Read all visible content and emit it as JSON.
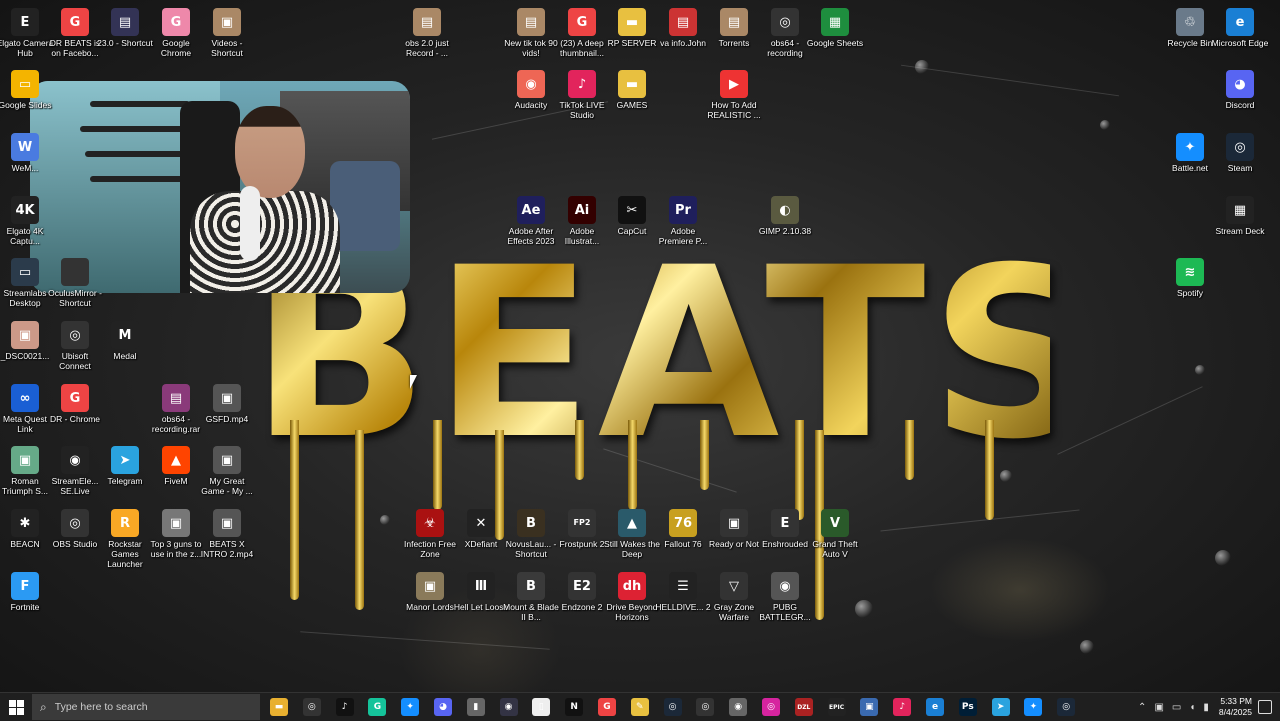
{
  "wallpaper": {
    "logo_text": "BEATS"
  },
  "desktop_icons": [
    {
      "label": "Elgato Camera Hub",
      "icon": "E",
      "color": "#222"
    },
    {
      "label": "DR BEATS is on Facebo...",
      "icon": "G",
      "color": "#e44"
    },
    {
      "label": "23.0 - Shortcut",
      "icon": "▤",
      "color": "#335"
    },
    {
      "label": "Google Chrome",
      "icon": "G",
      "color": "#e8a"
    },
    {
      "label": "Videos - Shortcut",
      "icon": "▣",
      "color": "#a86"
    },
    {
      "label": "obs 2.0 just Record - ...",
      "icon": "▤",
      "color": "#a86"
    },
    {
      "label": "New tik tok 90 vids!",
      "icon": "▤",
      "color": "#a86"
    },
    {
      "label": "(23) A deep thumbnail...",
      "icon": "G",
      "color": "#e44"
    },
    {
      "label": "RP SERVER",
      "icon": "▬",
      "color": "#e8c040"
    },
    {
      "label": "va info.John",
      "icon": "▤",
      "color": "#c33"
    },
    {
      "label": "Torrents",
      "icon": "▤",
      "color": "#a86"
    },
    {
      "label": "obs64 - recording",
      "icon": "◎",
      "color": "#333"
    },
    {
      "label": "Google Sheets",
      "icon": "▦",
      "color": "#1e8e3e"
    },
    {
      "label": "Recycle Bin",
      "icon": "♲",
      "color": "#6a7a8a"
    },
    {
      "label": "Microsoft Edge",
      "icon": "e",
      "color": "#1a7fd4"
    },
    {
      "label": "Google Slides",
      "icon": "▭",
      "color": "#f4b400"
    },
    {
      "label": "Audacity",
      "icon": "◉",
      "color": "#e65"
    },
    {
      "label": "TikTok LIVE Studio",
      "icon": "♪",
      "color": "#e2245c"
    },
    {
      "label": "GAMES",
      "icon": "▬",
      "color": "#e8c040"
    },
    {
      "label": "How To Add REALISTIC ...",
      "icon": "▶",
      "color": "#e33"
    },
    {
      "label": "Discord",
      "icon": "◕",
      "color": "#5865f2"
    },
    {
      "label": "WeM...",
      "icon": "W",
      "color": "#4a7be0"
    },
    {
      "label": "Battle.net",
      "icon": "✦",
      "color": "#148eff"
    },
    {
      "label": "Steam",
      "icon": "◎",
      "color": "#1b2838"
    },
    {
      "label": "Elgato 4K Captu...",
      "icon": "4K",
      "color": "#222"
    },
    {
      "label": "Adobe After Effects 2023",
      "icon": "Ae",
      "color": "#1f1f5c"
    },
    {
      "label": "Adobe Illustrat...",
      "icon": "Ai",
      "color": "#330000"
    },
    {
      "label": "CapCut",
      "icon": "✂",
      "color": "#111"
    },
    {
      "label": "Adobe Premiere P...",
      "icon": "Pr",
      "color": "#1f1f5c"
    },
    {
      "label": "GIMP 2.10.38",
      "icon": "◐",
      "color": "#5a5a40"
    },
    {
      "label": "Stream Deck",
      "icon": "▦",
      "color": "#222"
    },
    {
      "label": "Streamlabs Desktop",
      "icon": "▭",
      "color": "#2b3b4b"
    },
    {
      "label": "OculusMirror - Shortcut",
      "icon": "",
      "color": "#333"
    },
    {
      "label": "Spotify",
      "icon": "≋",
      "color": "#1db954"
    },
    {
      "label": "_DSC0021...",
      "icon": "▣",
      "color": "#c98"
    },
    {
      "label": "Ubisoft Connect",
      "icon": "◎",
      "color": "#333"
    },
    {
      "label": "Medal",
      "icon": "M",
      "color": "#222"
    },
    {
      "label": "Meta Quest Link",
      "icon": "∞",
      "color": "#1a5fd4"
    },
    {
      "label": "DR - Chrome",
      "icon": "G",
      "color": "#e44"
    },
    {
      "label": "obs64 - recording.rar",
      "icon": "▤",
      "color": "#8a3a7a"
    },
    {
      "label": "GSFD.mp4",
      "icon": "▣",
      "color": "#555"
    },
    {
      "label": "Roman Triumph S...",
      "icon": "▣",
      "color": "#6a8"
    },
    {
      "label": "StreamEle... SE.Live",
      "icon": "◉",
      "color": "#222"
    },
    {
      "label": "Telegram",
      "icon": "➤",
      "color": "#2aa3df"
    },
    {
      "label": "FiveM",
      "icon": "▲",
      "color": "#f40"
    },
    {
      "label": "My Great Game - My ...",
      "icon": "▣",
      "color": "#555"
    },
    {
      "label": "BEACN",
      "icon": "✱",
      "color": "#222"
    },
    {
      "label": "OBS Studio",
      "icon": "◎",
      "color": "#333"
    },
    {
      "label": "Rockstar Games Launcher",
      "icon": "R",
      "color": "#f9a825"
    },
    {
      "label": "Top 3 guns to use in the z...",
      "icon": "▣",
      "color": "#777"
    },
    {
      "label": "BEATS X INTRO 2.mp4",
      "icon": "▣",
      "color": "#555"
    },
    {
      "label": "Fortnite",
      "icon": "F",
      "color": "#2b9af3"
    },
    {
      "label": "Infection Free Zone",
      "icon": "☣",
      "color": "#a11"
    },
    {
      "label": "XDefiant",
      "icon": "✕",
      "color": "#222"
    },
    {
      "label": "NovusLau... - Shortcut",
      "icon": "B",
      "color": "#3a3020"
    },
    {
      "label": "Frostpunk 2",
      "icon": "FP2",
      "color": "#333"
    },
    {
      "label": "Still Wakes the Deep",
      "icon": "▲",
      "color": "#2a5a6a"
    },
    {
      "label": "Fallout 76",
      "icon": "76",
      "color": "#c8a020"
    },
    {
      "label": "Ready or Not",
      "icon": "▣",
      "color": "#333"
    },
    {
      "label": "Enshrouded",
      "icon": "E",
      "color": "#333"
    },
    {
      "label": "Grand Theft Auto V",
      "icon": "V",
      "color": "#2a5a2a"
    },
    {
      "label": "Manor Lords",
      "icon": "▣",
      "color": "#8a7a5a"
    },
    {
      "label": "Hell Let Loose",
      "icon": "Ⅲ",
      "color": "#222"
    },
    {
      "label": "Mount & Blade II B...",
      "icon": "B",
      "color": "#3a3a3a"
    },
    {
      "label": "Endzone 2",
      "icon": "E2",
      "color": "#333"
    },
    {
      "label": "Drive Beyond Horizons",
      "icon": "dh",
      "color": "#d23"
    },
    {
      "label": "HELLDIVE... 2",
      "icon": "☰",
      "color": "#222"
    },
    {
      "label": "Gray Zone Warfare",
      "icon": "▽",
      "color": "#333"
    },
    {
      "label": "PUBG BATTLEGR...",
      "icon": "◉",
      "color": "#555"
    }
  ],
  "taskbar": {
    "search_placeholder": "Type here to search",
    "apps": [
      {
        "name": "file-explorer",
        "icon": "▬",
        "color": "#e8b030"
      },
      {
        "name": "obs",
        "icon": "◎",
        "color": "#333"
      },
      {
        "name": "tiktok",
        "icon": "♪",
        "color": "#111"
      },
      {
        "name": "grammarly",
        "icon": "G",
        "color": "#15c39a"
      },
      {
        "name": "battle-net",
        "icon": "✦",
        "color": "#148eff"
      },
      {
        "name": "discord",
        "icon": "◕",
        "color": "#5865f2"
      },
      {
        "name": "usb-drive",
        "icon": "▮",
        "color": "#666"
      },
      {
        "name": "app-dark",
        "icon": "◉",
        "color": "#334"
      },
      {
        "name": "notepad",
        "icon": "▯",
        "color": "#eee"
      },
      {
        "name": "netflix",
        "icon": "N",
        "color": "#111"
      },
      {
        "name": "chrome",
        "icon": "G",
        "color": "#e44"
      },
      {
        "name": "pencil",
        "icon": "✎",
        "color": "#e8c040"
      },
      {
        "name": "steam",
        "icon": "◎",
        "color": "#1b2838"
      },
      {
        "name": "ubisoft",
        "icon": "◎",
        "color": "#333"
      },
      {
        "name": "app-swirl",
        "icon": "◉",
        "color": "#666"
      },
      {
        "name": "instagram",
        "icon": "◎",
        "color": "#d6249f"
      },
      {
        "name": "dzl",
        "icon": "DZL",
        "color": "#a22"
      },
      {
        "name": "epic",
        "icon": "EPIC",
        "color": "#222"
      },
      {
        "name": "app-window",
        "icon": "▣",
        "color": "#3a6ab0"
      },
      {
        "name": "tiktok-live",
        "icon": "♪",
        "color": "#e2245c"
      },
      {
        "name": "edge",
        "icon": "e",
        "color": "#1a7fd4"
      },
      {
        "name": "photoshop",
        "icon": "Ps",
        "color": "#001e36"
      },
      {
        "name": "telegram",
        "icon": "➤",
        "color": "#2aa3df"
      },
      {
        "name": "battle-net-2",
        "icon": "✦",
        "color": "#148eff"
      },
      {
        "name": "steam-2",
        "icon": "◎",
        "color": "#1b2838"
      }
    ],
    "clock_time": "5:33 PM",
    "clock_date": "8/4/2025"
  }
}
